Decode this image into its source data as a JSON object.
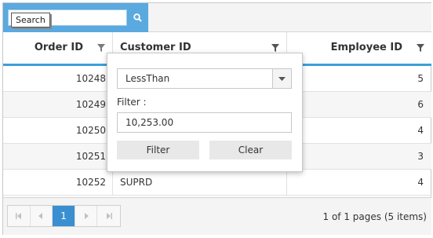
{
  "search": {
    "value": "",
    "tooltip": "Search",
    "icon": "search-icon"
  },
  "columns": [
    {
      "label": "Order ID",
      "align": "right"
    },
    {
      "label": "Customer ID",
      "align": "left"
    },
    {
      "label": "Employee ID",
      "align": "right"
    }
  ],
  "rows": [
    {
      "order_id": "10248",
      "customer_id": "",
      "employee_id": "5"
    },
    {
      "order_id": "10249",
      "customer_id": "",
      "employee_id": "6"
    },
    {
      "order_id": "10250",
      "customer_id": "",
      "employee_id": "4"
    },
    {
      "order_id": "10251",
      "customer_id": "",
      "employee_id": "3"
    },
    {
      "order_id": "10252",
      "customer_id": "SUPRD",
      "employee_id": "4"
    }
  ],
  "filter_popup": {
    "operator": "LessThan",
    "filter_label": "Filter :",
    "filter_value": "10,253.00",
    "filter_button": "Filter",
    "clear_button": "Clear"
  },
  "pager": {
    "current_page": "1",
    "info": "1 of 1 pages (5 items)"
  },
  "colors": {
    "accent": "#3aa0d8",
    "toolbar_search": "#5aa9df",
    "active_page": "#3a8fd0"
  }
}
